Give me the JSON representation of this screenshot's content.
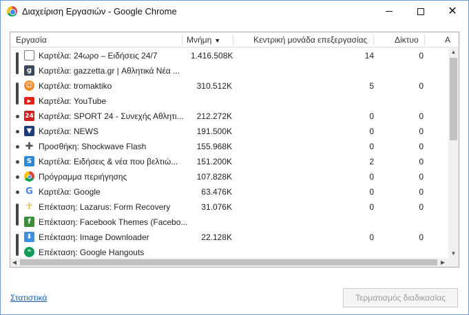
{
  "window": {
    "title": "Διαχείριση Εργασιών - Google Chrome"
  },
  "table": {
    "columns": {
      "task": "Εργασία",
      "memory": "Μνήμη",
      "cpu": "Κεντρική μονάδα επεξεργασίας",
      "network": "Δίκτυο",
      "extra": "A"
    },
    "sort_indicator": "▼",
    "rows": [
      {
        "name": "Καρτέλα: 24ωρο – Ειδήσεις 24/7",
        "memory": "1.416.508K",
        "cpu": "14",
        "network": "0",
        "icon": "document-icon"
      },
      {
        "name": "Καρτέλα: gazzetta.gr | Αθλητικά Νέα ...",
        "memory": "",
        "cpu": "",
        "network": "",
        "icon": "gazzetta-icon"
      },
      {
        "name": "Καρτέλα: tromaktiko",
        "memory": "310.512K",
        "cpu": "5",
        "network": "0",
        "icon": "tromaktiko-icon"
      },
      {
        "name": "Καρτέλα: YouTube",
        "memory": "",
        "cpu": "",
        "network": "",
        "icon": "youtube-icon"
      },
      {
        "name": "Καρτέλα: SPORT 24 - Συνεχής Αθλητι...",
        "memory": "212.272K",
        "cpu": "0",
        "network": "0",
        "icon": "sport24-icon"
      },
      {
        "name": "Καρτέλα: NEWS",
        "memory": "191.500K",
        "cpu": "0",
        "network": "0",
        "icon": "news-icon"
      },
      {
        "name": "Προσθήκη: Shockwave Flash",
        "memory": "155.968K",
        "cpu": "0",
        "network": "0",
        "icon": "puzzle-icon"
      },
      {
        "name": "Καρτέλα: Ειδήσεις & νέα που βελτιώ...",
        "memory": "151.200K",
        "cpu": "2",
        "network": "0",
        "icon": "news-s-icon"
      },
      {
        "name": "Πρόγραμμα περιήγησης",
        "memory": "107.828K",
        "cpu": "0",
        "network": "0",
        "icon": "chrome-icon"
      },
      {
        "name": "Καρτέλα: Google",
        "memory": "63.476K",
        "cpu": "0",
        "network": "0",
        "icon": "google-icon"
      },
      {
        "name": "Επέκταση: Lazarus: Form Recovery",
        "memory": "31.076K",
        "cpu": "0",
        "network": "0",
        "icon": "lazarus-icon"
      },
      {
        "name": "Επέκταση: Facebook Themes (Facebo...",
        "memory": "",
        "cpu": "",
        "network": "",
        "icon": "facebook-icon"
      },
      {
        "name": "Επέκταση: Image Downloader",
        "memory": "22.128K",
        "cpu": "0",
        "network": "0",
        "icon": "download-icon"
      },
      {
        "name": "Επέκταση: Google Hangouts",
        "memory": "",
        "cpu": "",
        "network": "",
        "icon": "hangouts-icon"
      }
    ]
  },
  "footer": {
    "stats_link": "Στατιστικά",
    "end_process_button": "Τερματισμός διαδικασίας"
  }
}
